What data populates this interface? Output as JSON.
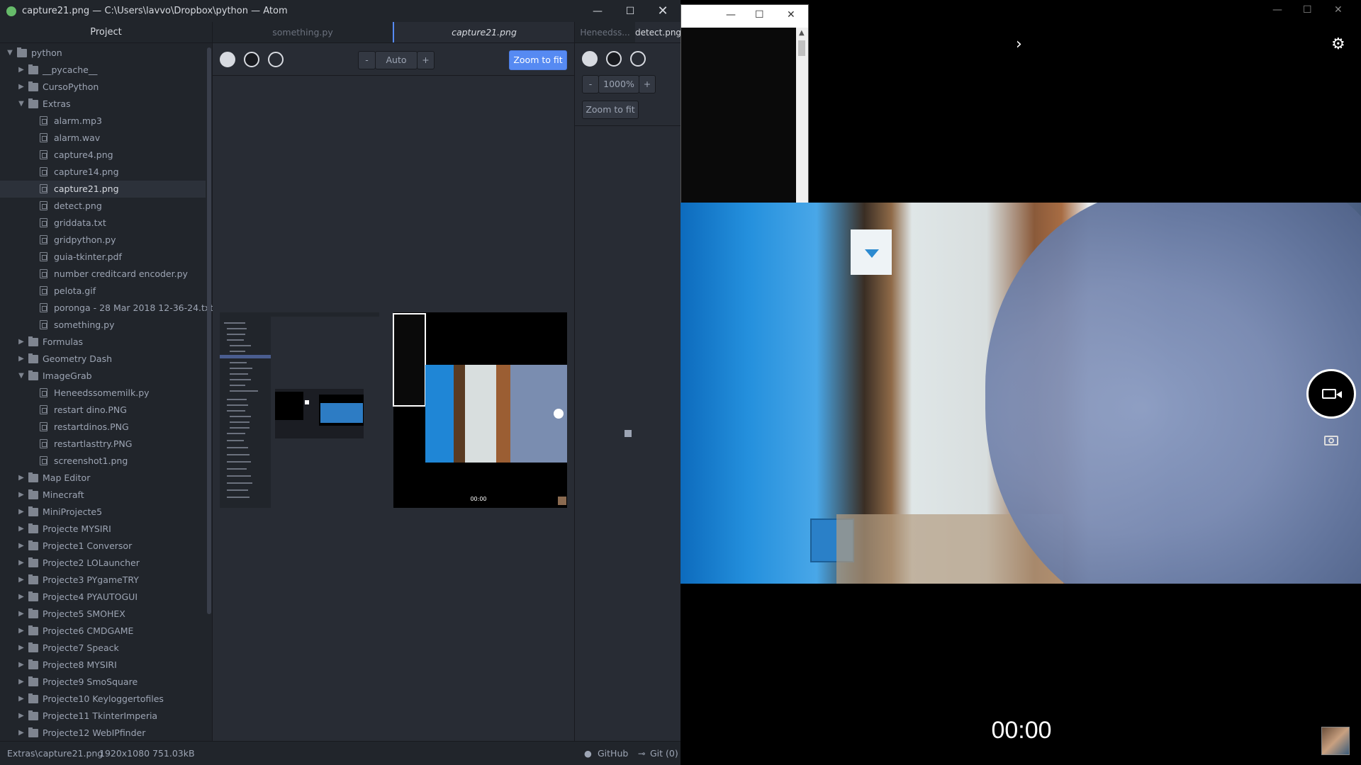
{
  "atom": {
    "title": "capture21.png — C:\\Users\\lavvo\\Dropbox\\python — Atom",
    "tree_header": "Project",
    "tree": [
      {
        "label": "python",
        "type": "folder",
        "depth": 0,
        "open": true
      },
      {
        "label": "__pycache__",
        "type": "folder",
        "depth": 1,
        "open": false
      },
      {
        "label": "CursoPython",
        "type": "folder",
        "depth": 1,
        "open": false
      },
      {
        "label": "Extras",
        "type": "folder",
        "depth": 1,
        "open": true
      },
      {
        "label": "alarm.mp3",
        "type": "file",
        "depth": 2
      },
      {
        "label": "alarm.wav",
        "type": "file",
        "depth": 2
      },
      {
        "label": "capture4.png",
        "type": "file",
        "depth": 2
      },
      {
        "label": "capture14.png",
        "type": "file",
        "depth": 2
      },
      {
        "label": "capture21.png",
        "type": "file",
        "depth": 2,
        "selected": true
      },
      {
        "label": "detect.png",
        "type": "file",
        "depth": 2
      },
      {
        "label": "griddata.txt",
        "type": "file",
        "depth": 2
      },
      {
        "label": "gridpython.py",
        "type": "file",
        "depth": 2
      },
      {
        "label": "guia-tkinter.pdf",
        "type": "file",
        "depth": 2
      },
      {
        "label": "number creditcard encoder.py",
        "type": "file",
        "depth": 2
      },
      {
        "label": "pelota.gif",
        "type": "file",
        "depth": 2
      },
      {
        "label": "poronga - 28 Mar 2018 12-36-24.txt",
        "type": "file",
        "depth": 2
      },
      {
        "label": "something.py",
        "type": "file",
        "depth": 2
      },
      {
        "label": "Formulas",
        "type": "folder",
        "depth": 1,
        "open": false
      },
      {
        "label": "Geometry Dash",
        "type": "folder",
        "depth": 1,
        "open": false
      },
      {
        "label": "ImageGrab",
        "type": "folder",
        "depth": 1,
        "open": true
      },
      {
        "label": "Heneedssomemilk.py",
        "type": "file",
        "depth": 2
      },
      {
        "label": "restart dino.PNG",
        "type": "file",
        "depth": 2
      },
      {
        "label": "restartdinos.PNG",
        "type": "file",
        "depth": 2
      },
      {
        "label": "restartlasttry.PNG",
        "type": "file",
        "depth": 2
      },
      {
        "label": "screenshot1.png",
        "type": "file",
        "depth": 2
      },
      {
        "label": "Map Editor",
        "type": "folder",
        "depth": 1,
        "open": false
      },
      {
        "label": "Minecraft",
        "type": "folder",
        "depth": 1,
        "open": false
      },
      {
        "label": "MiniProjecte5",
        "type": "folder",
        "depth": 1,
        "open": false
      },
      {
        "label": "Projecte MYSIRI",
        "type": "folder",
        "depth": 1,
        "open": false
      },
      {
        "label": "Projecte1 Conversor",
        "type": "folder",
        "depth": 1,
        "open": false
      },
      {
        "label": "Projecte2 LOLauncher",
        "type": "folder",
        "depth": 1,
        "open": false
      },
      {
        "label": "Projecte3 PYgameTRY",
        "type": "folder",
        "depth": 1,
        "open": false
      },
      {
        "label": "Projecte4 PYAUTOGUI",
        "type": "folder",
        "depth": 1,
        "open": false
      },
      {
        "label": "Projecte5 SMOHEX",
        "type": "folder",
        "depth": 1,
        "open": false
      },
      {
        "label": "Projecte6 CMDGAME",
        "type": "folder",
        "depth": 1,
        "open": false
      },
      {
        "label": "Projecte7 Speack",
        "type": "folder",
        "depth": 1,
        "open": false
      },
      {
        "label": "Projecte8 MYSIRI",
        "type": "folder",
        "depth": 1,
        "open": false
      },
      {
        "label": "Projecte9 SmoSquare",
        "type": "folder",
        "depth": 1,
        "open": false
      },
      {
        "label": "Projecte10 Keyloggertofiles",
        "type": "folder",
        "depth": 1,
        "open": false
      },
      {
        "label": "Projecte11 TkinterImperia",
        "type": "folder",
        "depth": 1,
        "open": false
      },
      {
        "label": "Projecte12 WebIPfinder",
        "type": "folder",
        "depth": 1,
        "open": false
      }
    ],
    "tabs": [
      "something.py",
      "capture21.png"
    ],
    "side_tabs": [
      "Heneedss...",
      "detect.png"
    ],
    "editor": {
      "zoom_minus": "-",
      "zoom_value": "Auto",
      "zoom_plus": "+",
      "zoom_fit": "Zoom to fit"
    },
    "side": {
      "zoom_minus": "-",
      "zoom_value": "1000%",
      "zoom_plus": "+",
      "zoom_fit": "Zoom to fit"
    },
    "status": {
      "path": "Extras\\capture21.png",
      "info": "1920x1080 751.03kB",
      "github": "GitHub",
      "git": "Git (0)"
    }
  },
  "camera": {
    "timer": "00:00",
    "preview_timer": "00:00"
  },
  "colors": {
    "accent": "#568af2",
    "tree_bg": "#21252b",
    "editor_bg": "#282c34"
  }
}
